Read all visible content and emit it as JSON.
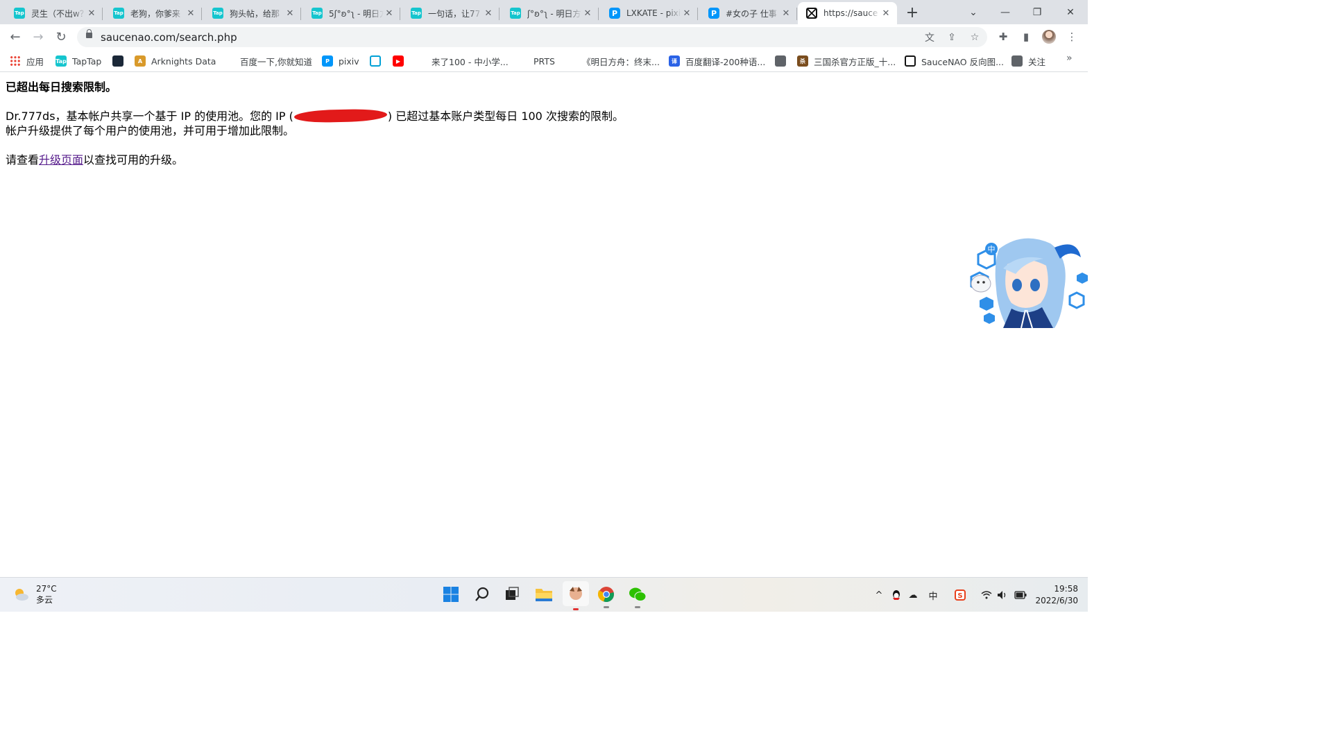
{
  "tabs": [
    {
      "title": "灵生（不出w？",
      "icon": "taptap"
    },
    {
      "title": "老狗，你爹来",
      "icon": "taptap"
    },
    {
      "title": "狗头帖，给那",
      "icon": "taptap"
    },
    {
      "title": "5ʃ°ʚ°ʅ - 明日方",
      "icon": "taptap"
    },
    {
      "title": "一句话，让77",
      "icon": "taptap"
    },
    {
      "title": "ʃ°ʚ°ʅ - 明日方",
      "icon": "taptap"
    },
    {
      "title": "LXKATE - pixiv",
      "icon": "pixiv"
    },
    {
      "title": "#女の子 仕事",
      "icon": "pixiv"
    },
    {
      "title": "https://sauce",
      "icon": "saucenao",
      "active": true
    }
  ],
  "toolbar": {
    "url": "saucenao.com/search.php"
  },
  "bookmarks": [
    {
      "label": "应用",
      "icon": "apps"
    },
    {
      "label": "TapTap",
      "icon": "taptap"
    },
    {
      "label": "",
      "icon": "steam"
    },
    {
      "label": "Arknights Data",
      "icon": "ark"
    },
    {
      "label": "百度一下,你就知道",
      "icon": "baidu"
    },
    {
      "label": "pixiv",
      "icon": "pixiv"
    },
    {
      "label": "",
      "icon": "bilibili"
    },
    {
      "label": "",
      "icon": "youtube"
    },
    {
      "label": "来了100 - 中小学...",
      "icon": "laile"
    },
    {
      "label": "PRTS",
      "icon": "prts"
    },
    {
      "label": "《明日方舟：终末...",
      "icon": "mrfz"
    },
    {
      "label": "百度翻译-200种语...",
      "icon": "fanyi"
    },
    {
      "label": "",
      "icon": "globe"
    },
    {
      "label": "三国杀官方正版_十...",
      "icon": "sgs"
    },
    {
      "label": "SauceNAO 反向图...",
      "icon": "saucenao"
    },
    {
      "label": "关注",
      "icon": "globe"
    }
  ],
  "page": {
    "heading": "已超出每日搜索限制。",
    "line1_start": "Dr.777ds，基本帐户共享一个基于 IP 的使用池。您的 IP",
    "line1_end": "已超过基本账户类型每日 100 次搜索的限制。",
    "line2": "帐户升级提供了每个用户的使用池，并可用于增加此限制。",
    "line3_start": "请查看",
    "link_text": "升级页面",
    "line3_end": "以查找可用的升级。"
  },
  "taskbar": {
    "temperature": "27°C",
    "weather_desc": "多云",
    "ime": "中",
    "time": "19:58",
    "date": "2022/6/30"
  },
  "colors": {
    "tabstrip_bg": "#dee1e6",
    "link_visited": "#551a8b",
    "redaction": "#e21a1a"
  }
}
